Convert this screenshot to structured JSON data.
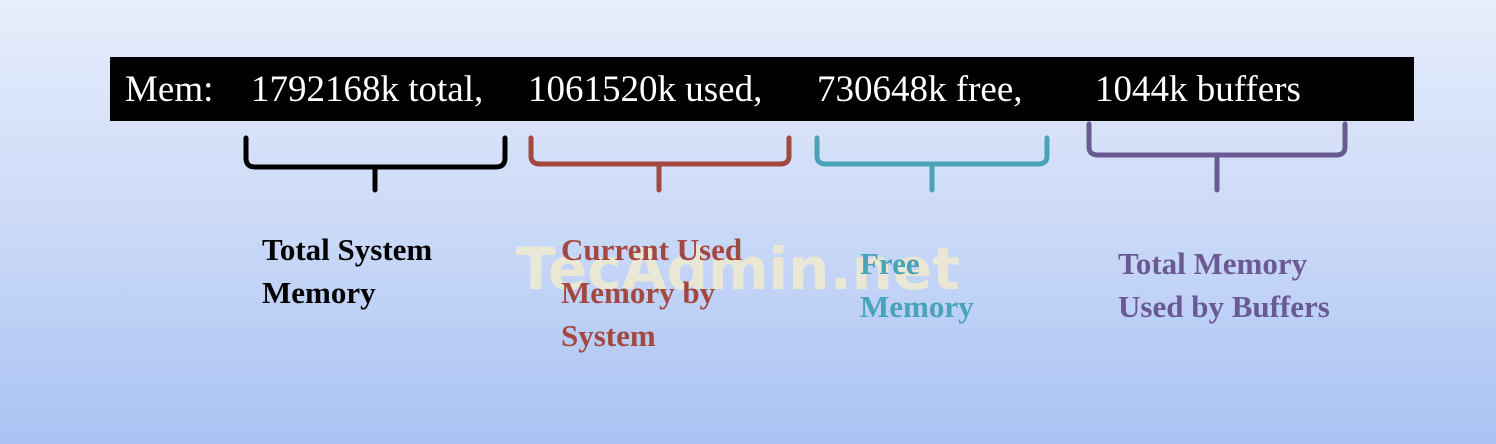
{
  "mem_line": {
    "prefix": "Mem:",
    "total": "1792168k total,",
    "used": "1061520k used,",
    "free": "730648k free,",
    "buffers": "1044k buffers"
  },
  "labels": {
    "total": [
      "Total System",
      "Memory"
    ],
    "used": [
      "Current Used",
      "Memory by",
      "System"
    ],
    "free": [
      "Free",
      "Memory"
    ],
    "buffers": [
      "Total Memory",
      "Used by Buffers"
    ]
  },
  "watermark": "TecAdmin.net",
  "colors": {
    "background_top": "#e6eefb",
    "background_bottom": "#a9c3f3",
    "bar": "#000000",
    "bar_text": "#ffffff",
    "total": "#000000",
    "used": "#a34840",
    "free": "#4aa3b7",
    "buffers": "#6a5a93"
  }
}
